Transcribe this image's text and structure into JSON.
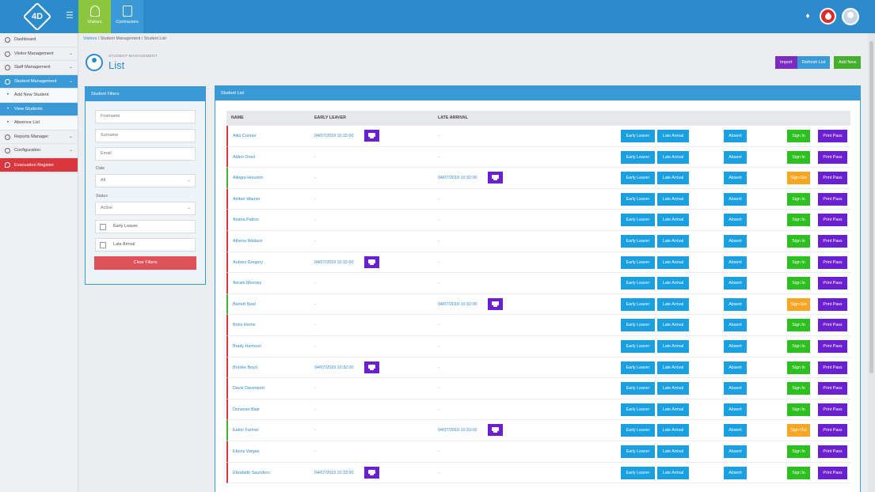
{
  "header": {
    "logo_text": "4D",
    "tabs": [
      {
        "label": "Visitors"
      },
      {
        "label": "Contractors"
      }
    ]
  },
  "sidebar": {
    "items": [
      {
        "label": "Dashboard"
      },
      {
        "label": "Visitor Management"
      },
      {
        "label": "Staff Management"
      },
      {
        "label": "Student Management"
      },
      {
        "label": "Add New Student"
      },
      {
        "label": "View Students"
      },
      {
        "label": "Absence List"
      },
      {
        "label": "Reports Manager"
      },
      {
        "label": "Configuration"
      },
      {
        "label": "Evacuation Register"
      }
    ]
  },
  "breadcrumb": {
    "root": "Visitors",
    "section": "Student Management",
    "current": "Student List"
  },
  "page": {
    "section": "STUDENT MANAGEMENT",
    "title": "List",
    "buttons": {
      "import": "Import",
      "refresh": "Refresh List",
      "add": "Add New"
    }
  },
  "filters": {
    "title": "Student Filters",
    "firstname_placeholder": "Firstname",
    "surname_placeholder": "Surname",
    "email_placeholder": "Email",
    "date_label": "Date",
    "date_value": "All",
    "status_label": "Status",
    "status_value": "Active",
    "early_leaver": "Early Leaver",
    "late_arrival": "Late Arrival",
    "clear": "Clear Filters"
  },
  "list": {
    "title": "Student List",
    "columns": {
      "name": "NAME",
      "early": "EARLY LEAVER",
      "late": "LATE ARRIVAL"
    },
    "buttons": {
      "early": "Early Leaver",
      "late": "Late Arrival",
      "absent": "Absent",
      "sign_in": "Sign In",
      "sign_out": "Sign Out",
      "print": "Print Pass"
    },
    "dash": "-",
    "rows": [
      {
        "name": "Aiko Conner",
        "early": "04/07/2019 10:32:00",
        "late": "-",
        "signed_in": false
      },
      {
        "name": "Alden Oneil",
        "early": "-",
        "late": "-",
        "signed_in": false
      },
      {
        "name": "Allegra Houston",
        "early": "-",
        "late": "04/07/2019 10:32:00",
        "signed_in": true
      },
      {
        "name": "Amber Warner",
        "early": "-",
        "late": "-",
        "signed_in": false
      },
      {
        "name": "Ariana Patton",
        "early": "-",
        "late": "-",
        "signed_in": false
      },
      {
        "name": "Athena Wallace",
        "early": "-",
        "late": "-",
        "signed_in": false
      },
      {
        "name": "Aubrey Gregory",
        "early": "04/07/2019 10:32:00",
        "late": "-",
        "signed_in": false
      },
      {
        "name": "Avram Mooney",
        "early": "-",
        "late": "-",
        "signed_in": false
      },
      {
        "name": "Barrett Neal",
        "early": "-",
        "late": "04/07/2019 10:32:00",
        "signed_in": true
      },
      {
        "name": "Boris Horne",
        "early": "-",
        "late": "-",
        "signed_in": false
      },
      {
        "name": "Brady Harrison",
        "early": "-",
        "late": "-",
        "signed_in": false
      },
      {
        "name": "Brooke Boyd",
        "early": "04/07/2019 10:32:00",
        "late": "-",
        "signed_in": false
      },
      {
        "name": "Davis Davenport",
        "early": "-",
        "late": "-",
        "signed_in": false
      },
      {
        "name": "Donovan Blair",
        "early": "-",
        "late": "-",
        "signed_in": false
      },
      {
        "name": "Eaton Farmer",
        "early": "-",
        "late": "04/07/2019 10:33:00",
        "signed_in": true
      },
      {
        "name": "Ebony Vargas",
        "early": "-",
        "late": "-",
        "signed_in": false
      },
      {
        "name": "Elizabeth Saunders",
        "early": "04/07/2019 10:33:00",
        "late": "-",
        "signed_in": false
      }
    ]
  }
}
